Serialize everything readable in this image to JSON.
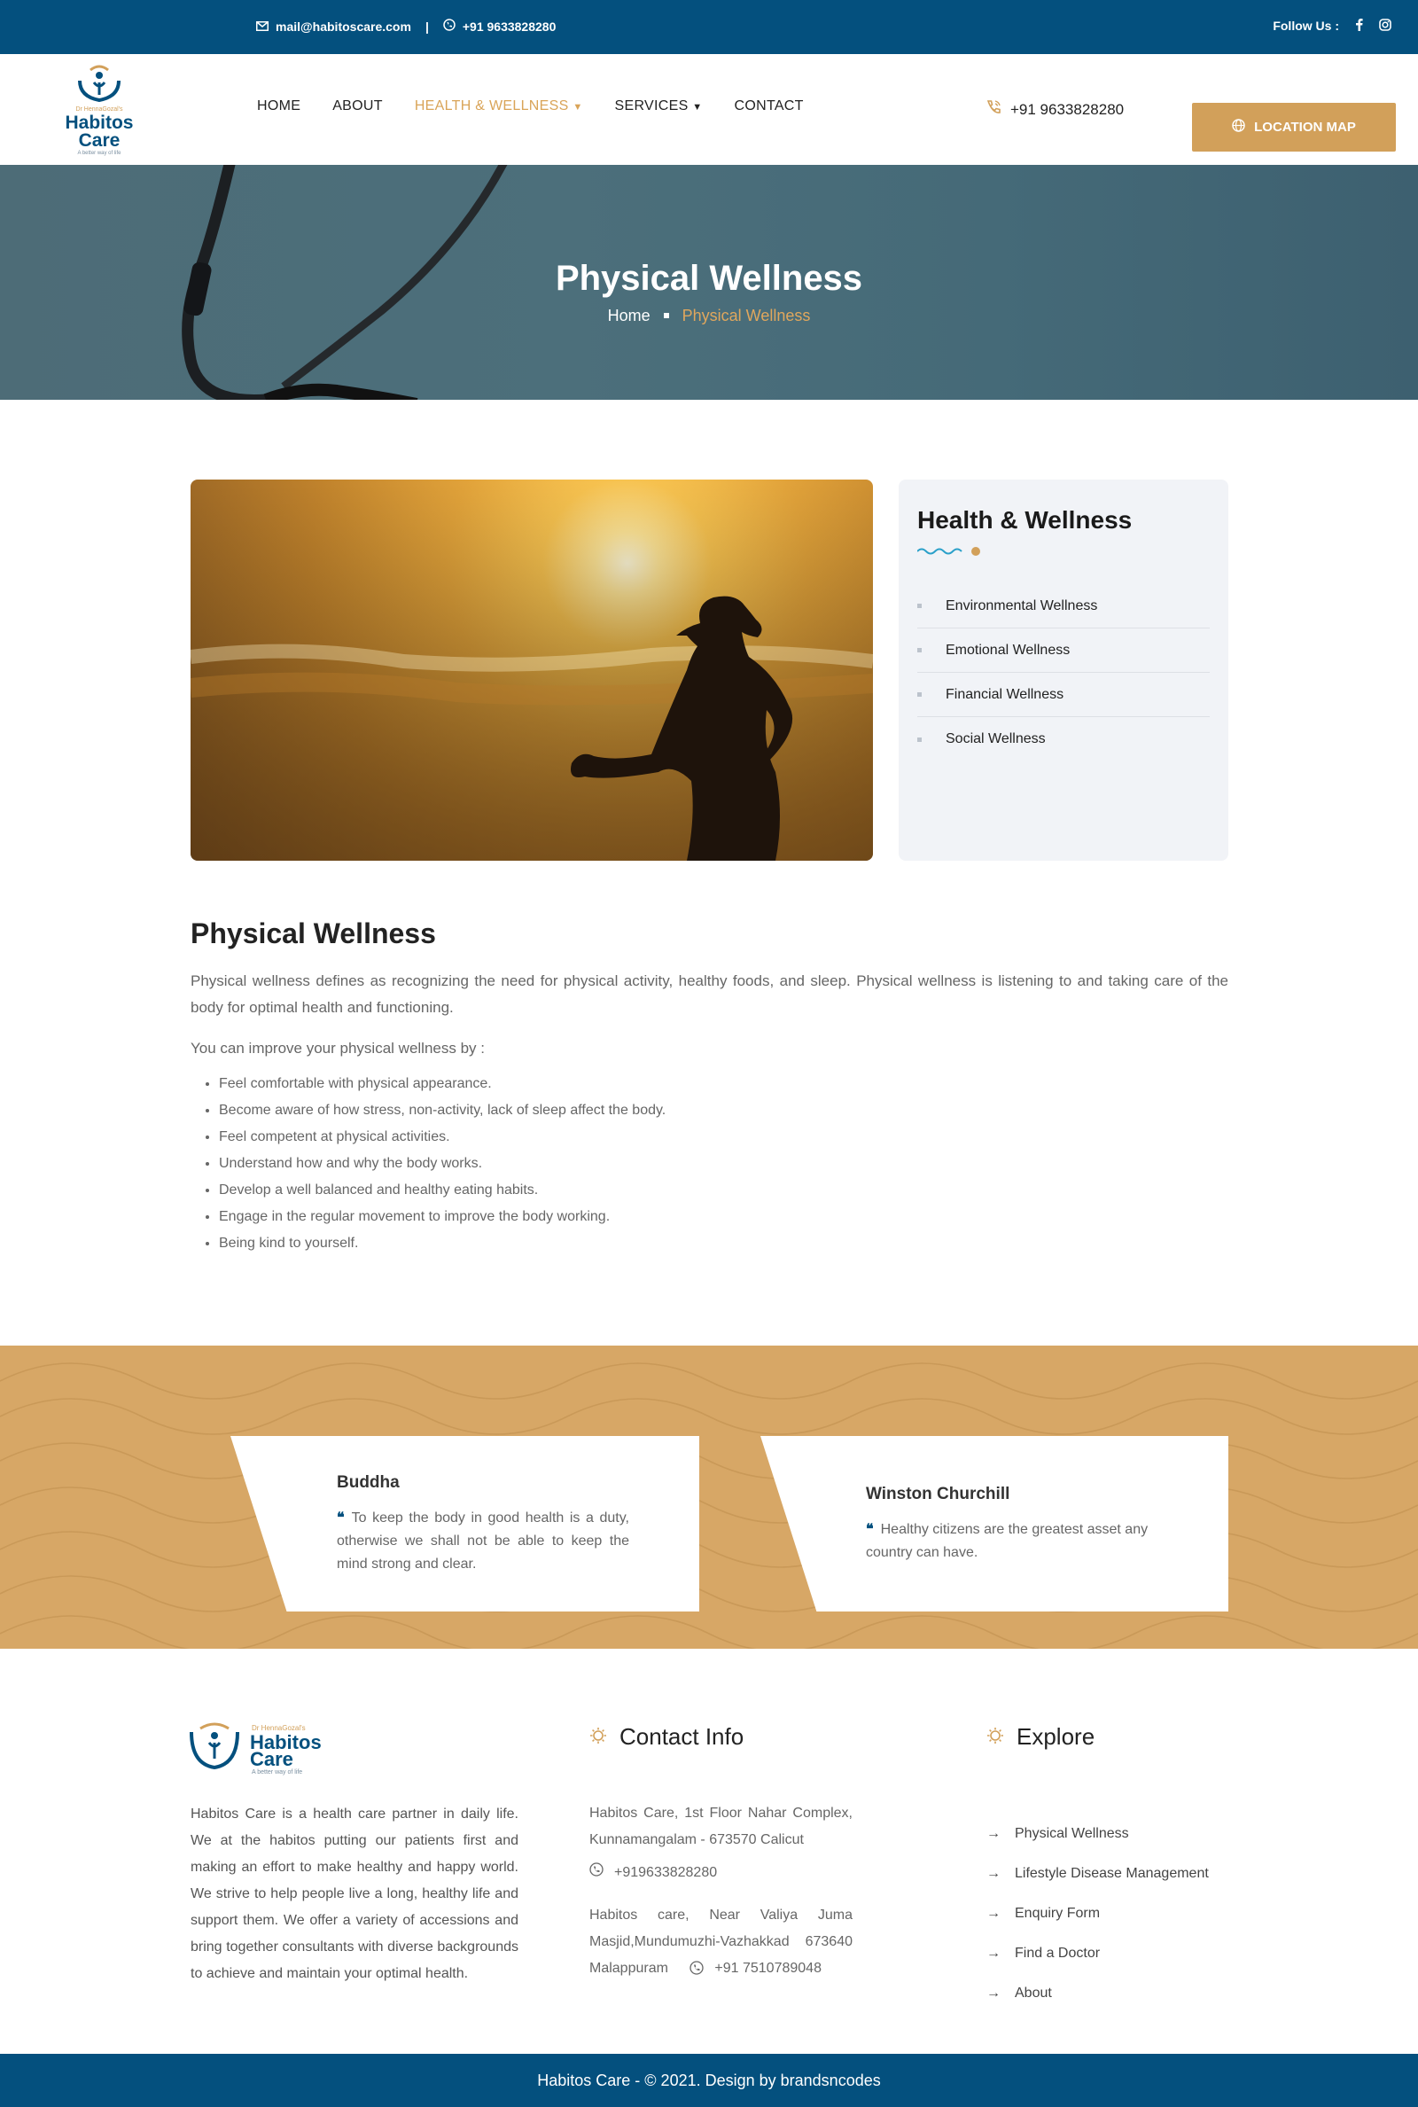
{
  "topbar": {
    "email": "mail@habitoscare.com",
    "separator": "|",
    "phone": "+91 9633828280",
    "follow_label": "Follow Us :",
    "social_icons": [
      "facebook-icon",
      "instagram-icon"
    ]
  },
  "logo": {
    "tagline_top": "Dr HennaGozal's",
    "name_line1": "Habitos",
    "name_line2": "Care",
    "tagline_bottom": "A better way of life"
  },
  "nav": {
    "items": [
      {
        "label": "HOME",
        "active": false
      },
      {
        "label": "ABOUT",
        "active": false
      },
      {
        "label": "HEALTH & WELLNESS",
        "active": true,
        "dropdown": true
      },
      {
        "label": "SERVICES",
        "active": false,
        "dropdown": true
      },
      {
        "label": "CONTACT",
        "active": false
      }
    ],
    "phone": "+91 9633828280",
    "location_button": "LOCATION MAP"
  },
  "hero": {
    "title": "Physical Wellness",
    "breadcrumb": [
      "Home",
      "Physical Wellness"
    ]
  },
  "sidebar": {
    "title": "Health & Wellness",
    "items": [
      "Environmental Wellness",
      "Emotional Wellness",
      "Financial Wellness",
      "Social Wellness"
    ]
  },
  "content": {
    "title": "Physical Wellness",
    "intro": "Physical wellness defines as recognizing the need for physical activity, healthy foods, and sleep. Physical wellness is listening to and taking care of the body for optimal health and functioning.",
    "improve_label": "You can improve your physical wellness by :",
    "list": [
      "Feel comfortable with physical appearance.",
      "Become aware of how stress, non-activity, lack of sleep affect the body.",
      "Feel competent at physical activities.",
      "Understand how and why the body works.",
      "Develop a well balanced and healthy eating habits.",
      "Engage in the regular movement to improve the body working.",
      "Being kind to yourself."
    ]
  },
  "quotes": [
    {
      "author": "Buddha",
      "text": "To keep the body in good health is a duty, otherwise we shall not be able to keep the mind strong and clear."
    },
    {
      "author": "Winston Churchill",
      "text": "Healthy citizens are the greatest asset any country can have."
    }
  ],
  "footer": {
    "about": "Habitos Care is a health care partner in daily life. We at the habitos putting our patients first and making an effort to make healthy and happy world. We strive to help people live a long, healthy life and support them. We offer a variety of accessions and bring together consultants with diverse backgrounds to achieve and maintain your optimal health.",
    "contact_title": "Contact Info",
    "address1": "Habitos Care, 1st Floor Nahar Complex, Kunnamangalam - 673570 Calicut",
    "phone1": "+919633828280",
    "address2": "Habitos care, Near Valiya Juma Masjid,Mundumuzhi-Vazhakkad 673640 Malappuram",
    "phone2": "+91 7510789048",
    "explore_title": "Explore",
    "explore": [
      "Physical Wellness",
      "Lifestyle Disease Management",
      "Enquiry Form",
      "Find a Doctor",
      "About"
    ],
    "copyright": "Habitos Care - © 2021. Design by brandsncodes"
  },
  "colors": {
    "brand_blue": "#04507e",
    "accent_gold": "#d2a05a",
    "sidebar_bg": "#f1f3f7"
  }
}
